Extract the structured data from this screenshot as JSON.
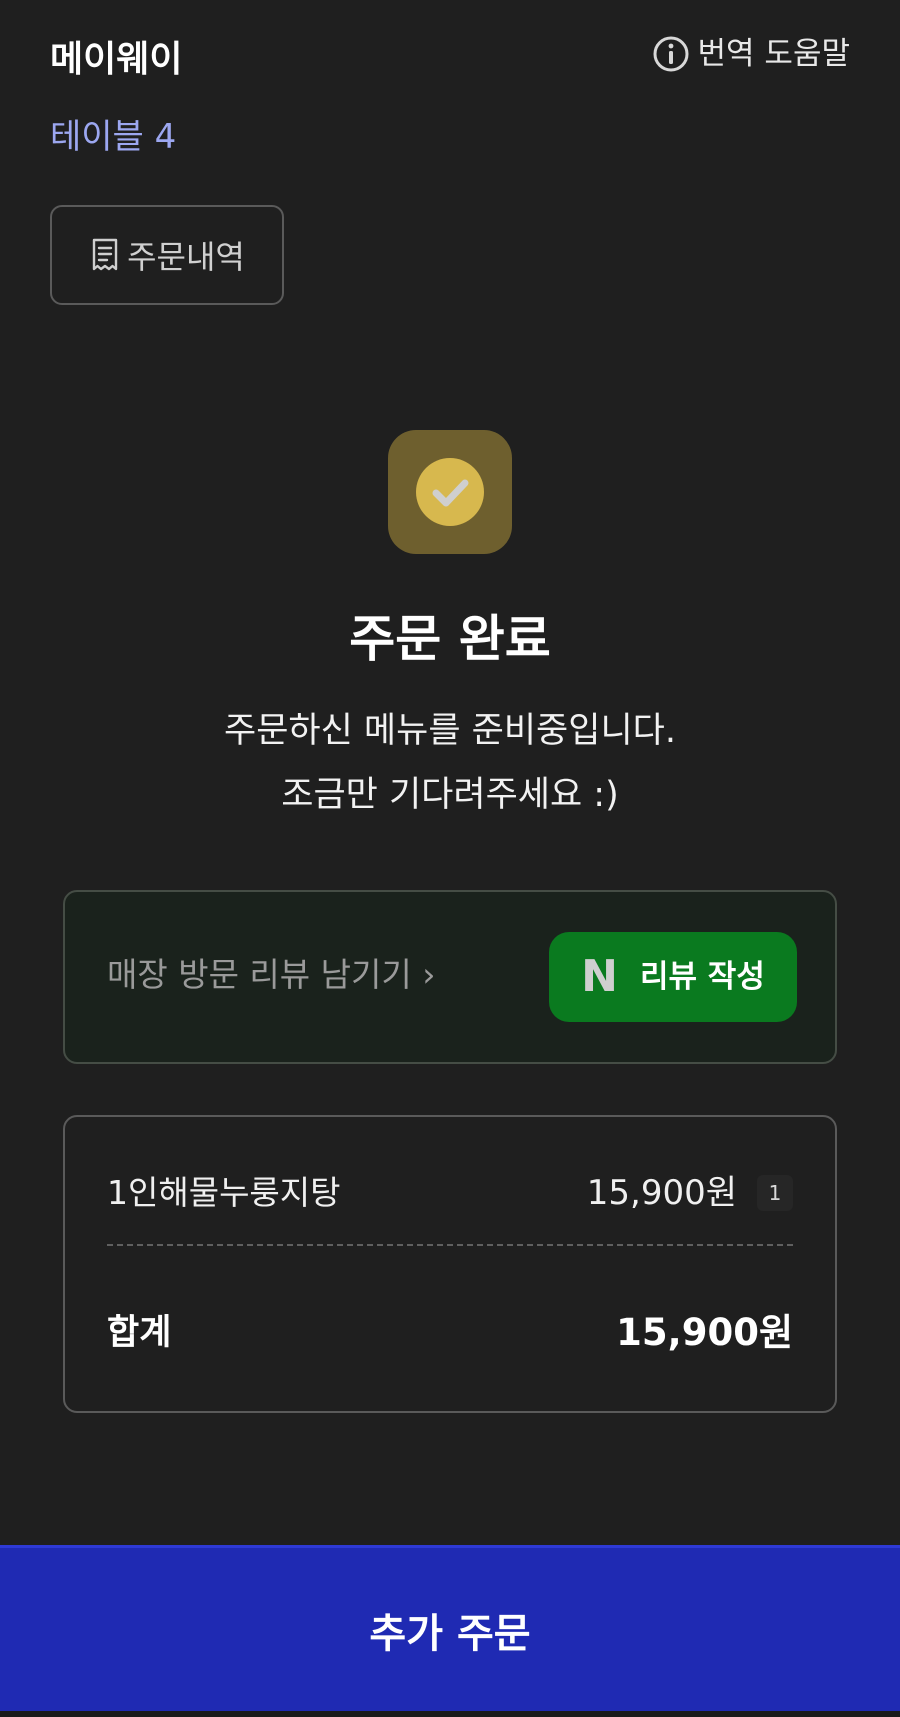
{
  "header": {
    "store_name": "메이웨이",
    "translate_help": "번역 도움말",
    "table_label": "테이블 4"
  },
  "order_history": {
    "label": "주문내역"
  },
  "status": {
    "title": "주문 완료",
    "line1": "주문하신 메뉴를 준비중입니다.",
    "line2": "조금만 기다려주세요 :)"
  },
  "review": {
    "prompt": "매장 방문 리뷰 남기기 ›",
    "button_logo": "N",
    "button_label": "리뷰 작성"
  },
  "order_summary": {
    "items": [
      {
        "name": "1인해물누룽지탕",
        "price": "15,900원",
        "qty": "1"
      }
    ],
    "total_label": "합계",
    "total_value": "15,900원"
  },
  "footer": {
    "add_order_label": "추가 주문"
  },
  "colors": {
    "background": "#1f1f1f",
    "table_label": "#9ca7f0",
    "check_tile": "#6e5f2e",
    "check_circle": "#d7b84e",
    "review_button": "#0a7a1f",
    "add_order_button": "#1f2ab3"
  },
  "icons": {
    "translate_help": "info-icon",
    "order_history": "receipt-icon",
    "status": "check-circle-icon",
    "review_logo": "naver-logo-icon"
  }
}
